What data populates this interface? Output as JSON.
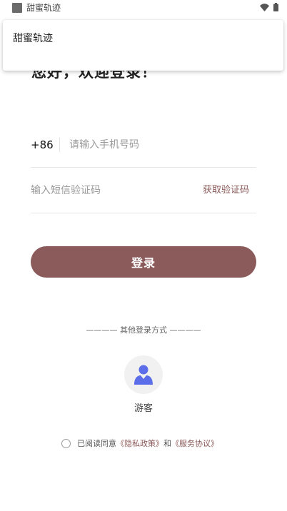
{
  "status_bar": {
    "app_name": "甜蜜轨迹"
  },
  "notification": {
    "title": "甜蜜轨迹"
  },
  "login": {
    "greeting": "您好，欢迎登录！",
    "country_code": "+86",
    "phone_placeholder": "请输入手机号码",
    "code_placeholder": "输入短信验证码",
    "get_code_label": "获取验证码",
    "login_label": "登录"
  },
  "other_login": {
    "title": "———— 其他登录方式 ————",
    "guest_label": "游客"
  },
  "agreement": {
    "prefix": "已阅读同意",
    "privacy_link": "《隐私政策》",
    "conjunction": "和",
    "service_link": "《服务协议》"
  },
  "colors": {
    "accent": "#8b5a5b",
    "link": "#8b5858",
    "guest_icon": "#5b6de8"
  },
  "icons": {
    "status_app": "square-icon",
    "wifi": "wifi-icon",
    "battery": "battery-icon",
    "guest": "user-icon"
  }
}
